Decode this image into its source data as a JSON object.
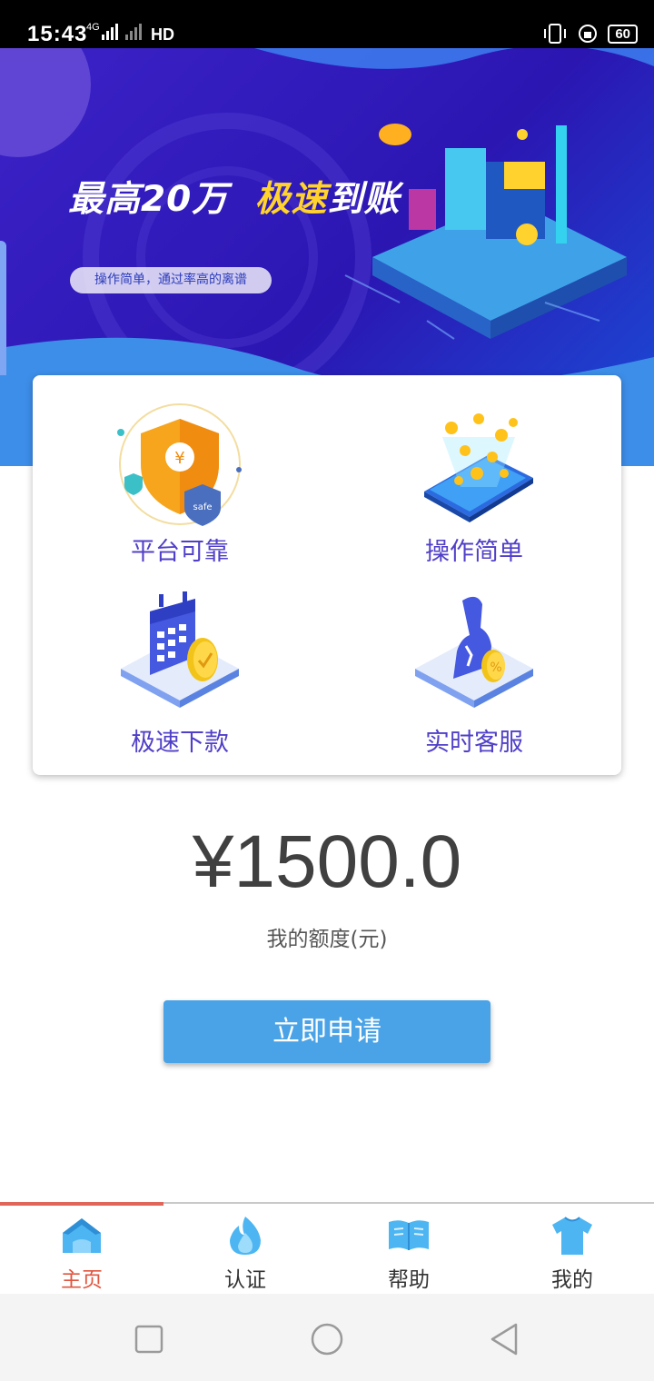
{
  "status_bar": {
    "time": "15:43",
    "network": "4G",
    "hd": "HD",
    "battery": "60"
  },
  "banner": {
    "title_part1": "最高20万",
    "title_part2": "极速",
    "title_part3": "到账",
    "subtitle": "操作简单，通过率高的离谱",
    "colors": {
      "background": "#2b16b2",
      "accent": "#ffd22d"
    }
  },
  "features": [
    {
      "label": "平台可靠",
      "icon": "shield-yuan-icon"
    },
    {
      "label": "操作简单",
      "icon": "phone-coins-icon"
    },
    {
      "label": "极速下款",
      "icon": "calendar-check-icon"
    },
    {
      "label": "实时客服",
      "icon": "customer-service-icon"
    }
  ],
  "credit": {
    "amount": "¥1500.0",
    "label": "我的额度(元)"
  },
  "apply_button": {
    "label": "立即申请",
    "color": "#4aa3e6"
  },
  "tabbar": {
    "tabs": [
      {
        "label": "主页",
        "icon": "home-icon",
        "active": true
      },
      {
        "label": "认证",
        "icon": "flame-icon",
        "active": false
      },
      {
        "label": "帮助",
        "icon": "book-icon",
        "active": false
      },
      {
        "label": "我的",
        "icon": "shirt-icon",
        "active": false
      }
    ],
    "active_color": "#e0553f"
  },
  "nav_bar": {
    "buttons": [
      "recent-apps",
      "home",
      "back"
    ]
  }
}
